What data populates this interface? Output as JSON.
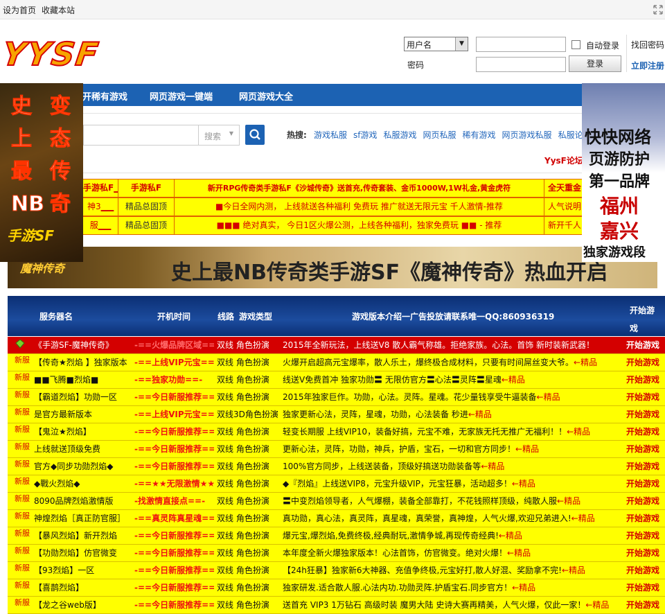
{
  "topbar": {
    "home": "设为首页",
    "favorite": "收藏本站"
  },
  "logo": {
    "text": "YYSF"
  },
  "login": {
    "select_value": "用户名",
    "password_label": "密码",
    "auto_login": "自动登录",
    "login_button": "登录",
    "find_password": "找回密码",
    "register": "立即注册"
  },
  "nav": {
    "items": [
      "开稀有游戏",
      "网页游戏一键端",
      "网页游戏大全"
    ]
  },
  "search": {
    "select": "搜索",
    "hot_label": "热搜:",
    "hot_terms": [
      "游戏私服",
      "sf游戏",
      "私服游戏",
      "网页私服",
      "稀有游戏",
      "网页游戏私服",
      "私服论坛"
    ],
    "forum_link": "YysF论坛"
  },
  "yellow_table": {
    "rows": [
      [
        "手游私F▁▁",
        "手游私F",
        "新开RPG传奇类手游私F《沙城传奇》送首充,传奇套装、金币1000W,1W礼金,黄金虎符",
        "全天重金"
      ],
      [
        "神3▁▁",
        "精品总固顶",
        "■今日全网内测，   上线就送各种福利  免费玩  推广就送无限元宝  千人激情-推荐",
        "人气说明"
      ],
      [
        "服▁▁",
        "精品总固顶",
        "■■■  绝对真实，  今日1区火爆公测，上线各种福利，独家免费玩     ■■  - 推荐",
        "新开千人"
      ]
    ]
  },
  "left_ad": {
    "col1": [
      "史",
      "上",
      "最",
      "NB"
    ],
    "col2": [
      "变",
      "态",
      "传",
      "奇"
    ],
    "footer": "手游SF"
  },
  "right_ad": {
    "lines": [
      "快快网络",
      "页游防护",
      "第一品牌",
      "福州",
      "嘉兴",
      "独家游戏段"
    ]
  },
  "banner": {
    "logo": "魔神传奇",
    "text": "史上最NB传奇类手游SF《魔神传奇》热血开启"
  },
  "table": {
    "headers": {
      "name": "服务器名",
      "time": "开机时间",
      "line": "线路",
      "type": "游戏类型",
      "desc": "游戏版本介绍一广告投放请联系唯一QQ:860936319",
      "start": "开始游戏"
    },
    "rows": [
      {
        "badge": "",
        "name": "《手游SF-魔神传奇》",
        "time": "-==火爆品牌区域==-",
        "line": "双线   角色扮演",
        "desc": "2015年全新玩法，上线送V8 散人霸气称雄。拒绝家族。心法。首饰 新时装新武器！",
        "arrow": "",
        "start": "开始游戏"
      },
      {
        "badge": "新服",
        "name": "【传奇★烈焰 】独家版本",
        "time": "-==上线VIP元宝==-",
        "line": "双线   角色扮演",
        "desc": "火爆开启超高元宝爆率，散人乐土，爆终极合成材料，只要有时间屌丝变大爷。",
        "arrow": "←精品",
        "start": "开始游戏"
      },
      {
        "badge": "新服",
        "name": "■■飞腾■烈焰■",
        "time": "-==独家功勋==-",
        "line": "双线   角色扮演",
        "desc": "线送V免费首冲 独家功勋〓 无限仿官方〓心法〓灵阵〓星魂",
        "arrow": "←精品",
        "start": "开始游戏"
      },
      {
        "badge": "新服",
        "name": "【霸道烈焰】功勋一区",
        "time": "-==今日新服推荐==-",
        "line": "双线   角色扮演",
        "desc": "2015年独家巨作。功勋，心法。灵阵。星魂。花少量钱享受牛逼装备",
        "arrow": "←精品",
        "start": "开始游戏"
      },
      {
        "badge": "新服",
        "name": "是官方最新版本",
        "time": "-==上线VIP元宝==-",
        "line": "双线3D角色扮演",
        "desc": "独家更新心法，灵阵，星魂，功勋，心法装备 秒进",
        "arrow": "←精品",
        "start": "开始游戏"
      },
      {
        "badge": "新服",
        "name": "【鬼泣★烈焰】",
        "time": "-==今日新服推荐==-",
        "line": "双线   角色扮演",
        "desc": "轻变长期服 上线VIP10，装备好搞，元宝不难，无家族无托无推广无福利！！",
        "arrow": "←精品",
        "start": "开始游戏"
      },
      {
        "badge": "新服",
        "name": "上线就送顶级免费",
        "time": "-==今日新服推荐==-",
        "line": "双线   角色扮演",
        "desc": "更新心法，灵阵，功勋，神兵，护盾，宝石，一切和官方同步！",
        "arrow": "←精品",
        "start": "开始游戏"
      },
      {
        "badge": "新服",
        "name": "官方◆同步功勋烈焰◆",
        "time": "-==今日新服推荐==-",
        "line": "双线   角色扮演",
        "desc": "100%官方同步，上线送装备，顶级好搞送功勋装备等",
        "arrow": "←精品",
        "start": "开始游戏"
      },
      {
        "badge": "新服",
        "name": "◆戰火烈焰◆",
        "time": "-==★★无限激情★★==-",
        "line": "双线   角色扮演",
        "desc": "◆『烈焰』上线送VIP8，元宝升级VIP，元宝狂暴，活动超多！",
        "arrow": "←精品",
        "start": "开始游戏"
      },
      {
        "badge": "新服",
        "name": "8090品牌烈焰激情版",
        "time": "-找激情直接点==-",
        "line": "双线   角色扮演",
        "desc": "〓中变烈焰领导者，人气爆棚，装备全部靠打，不花钱照样顶级，纯散人服",
        "arrow": "←精品",
        "start": "开始游戏"
      },
      {
        "badge": "新服",
        "name": "神煌烈焰［真正防官服］",
        "time": "-==真灵阵真星魂==-",
        "line": "双线   角色扮演",
        "desc": "真功勋，真心法，真灵阵，真星魂，真荣誉，真神煌，人气火爆,欢迎兄弟进入!",
        "arrow": "←精品",
        "start": "开始游戏"
      },
      {
        "badge": "新服",
        "name": "【暴风烈焰】新开烈焰",
        "time": "-==今日新服推荐==-",
        "line": "双线   角色扮演",
        "desc": "爆元宝,爆烈焰,免费终极,经典耐玩,激情争城,再现传奇经典!",
        "arrow": "←精品",
        "start": "开始游戏"
      },
      {
        "badge": "新服",
        "name": "【功勋烈焰】仿官微变",
        "time": "-==今日新服推荐==-",
        "line": "双线   角色扮演",
        "desc": "本年度全新火爆独家版本！心法首饰，仿官微变。绝对火爆！",
        "arrow": "←精品",
        "start": "开始游戏"
      },
      {
        "badge": "新服",
        "name": "【93烈焰】一区",
        "time": "-==今日新服推荐==-",
        "line": "双线   角色扮演",
        "desc": "【24h狂暴】独家新6大神器、充值争终极,元宝好打,散人好混、奖励拿不完!",
        "arrow": "←精品",
        "start": "开始游戏"
      },
      {
        "badge": "新服",
        "name": "【喜鹊烈焰】",
        "time": "-==今日新服推荐==-",
        "line": "双线   角色扮演",
        "desc": "独家研发.适合散人服.心法内功.功勋灵阵.护盾宝石.同步官方！",
        "arrow": "←精品",
        "start": "开始游戏"
      },
      {
        "badge": "新服",
        "name": "【龙之谷web版】",
        "time": "-==今日新服推荐==-",
        "line": "双线   角色扮演",
        "desc": "送首充  VIP3  1万钻石 高级时装 魔男大陆  史诗大赛再精美，人气火爆，仅此一家！",
        "arrow": "←精品",
        "start": "开始游戏"
      }
    ]
  }
}
